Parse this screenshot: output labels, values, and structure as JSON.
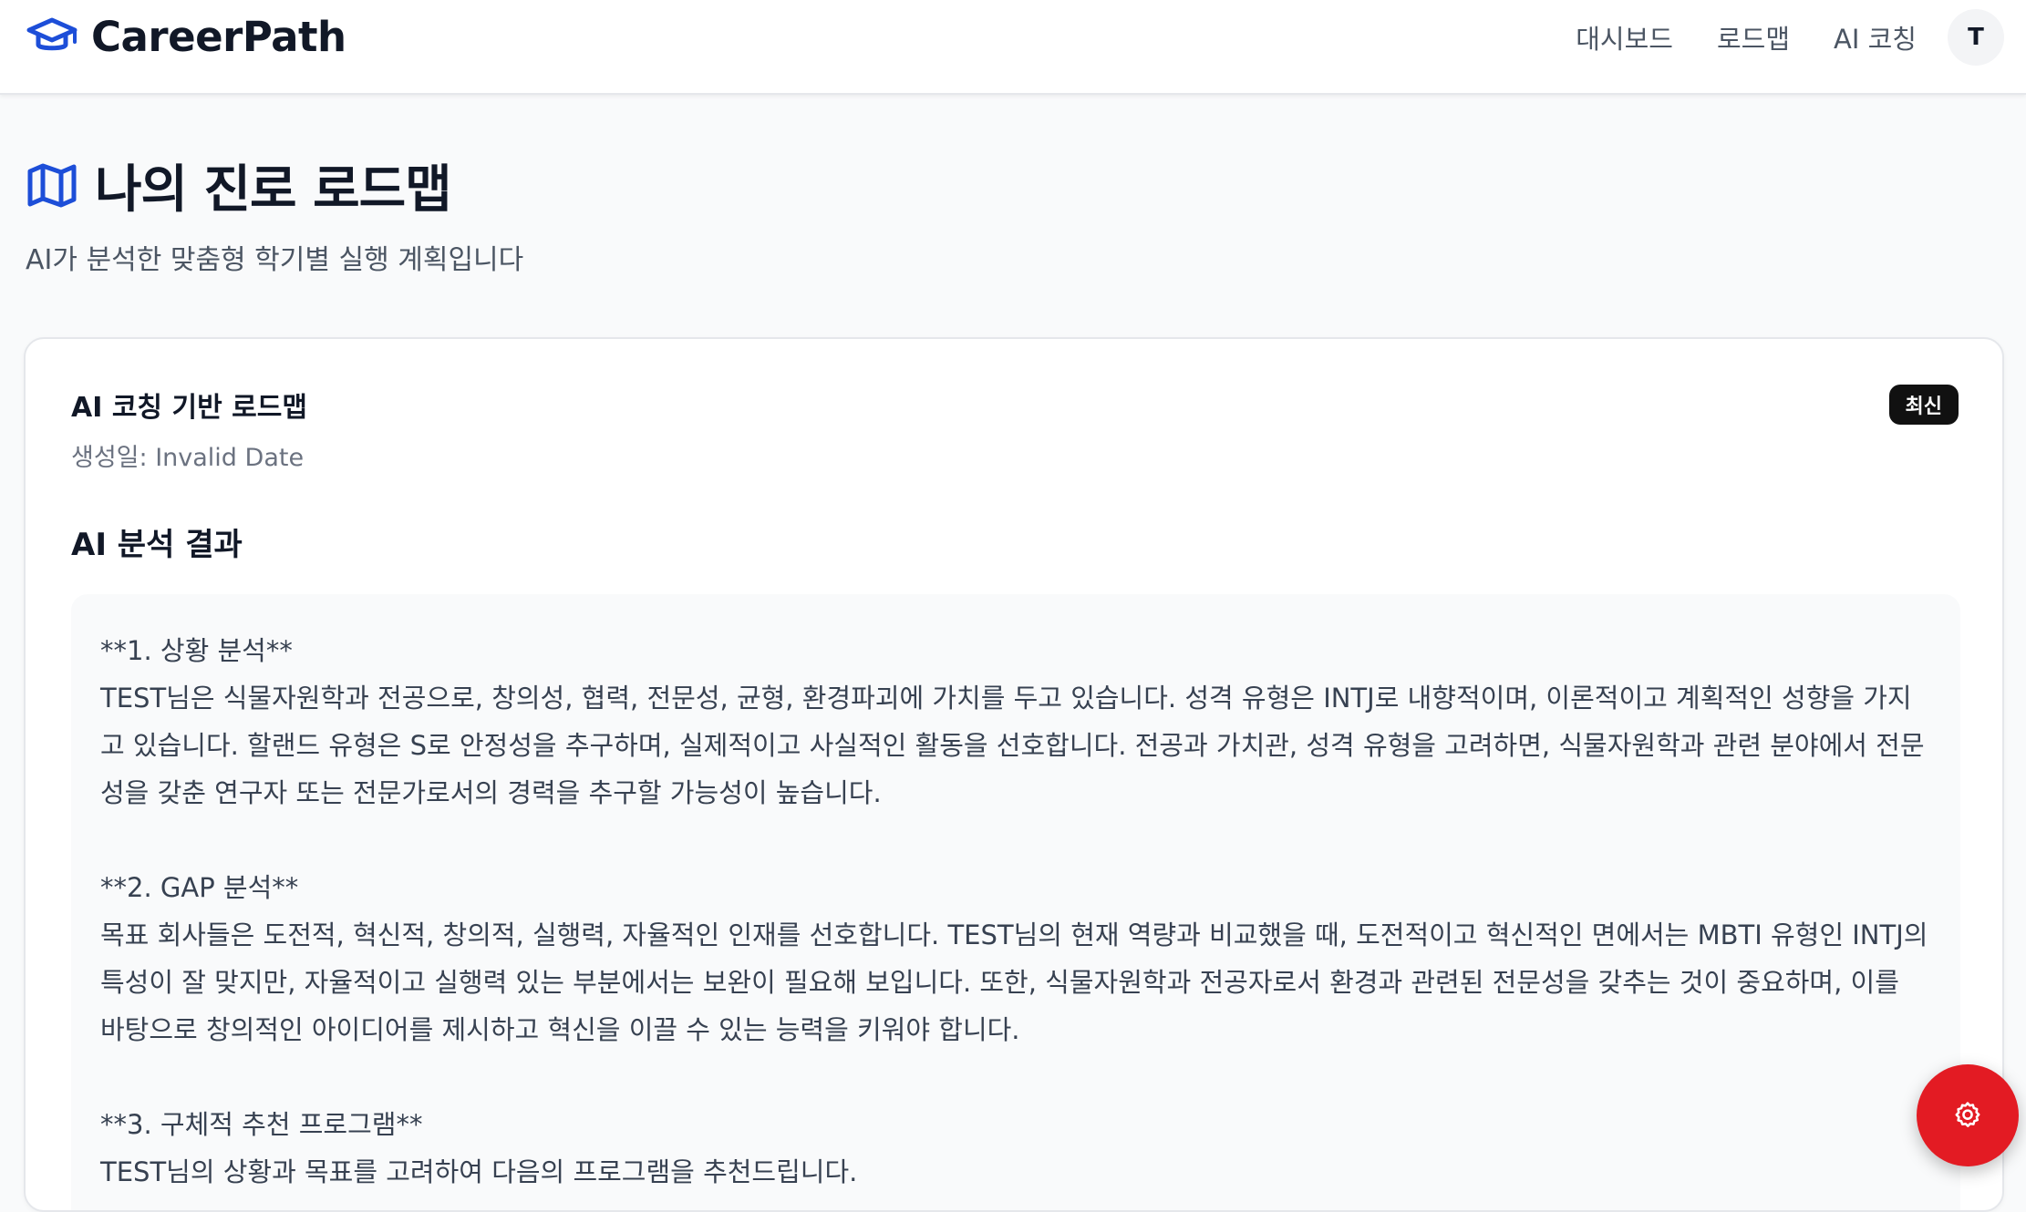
{
  "header": {
    "brand": "CareerPath",
    "nav": [
      "대시보드",
      "로드맵",
      "AI 코칭"
    ],
    "avatar_initial": "T"
  },
  "page": {
    "title": "나의 진로 로드맵",
    "subtitle": "AI가 분석한 맞춤형 학기별 실행 계획입니다"
  },
  "card": {
    "title": "AI 코칭 기반 로드맵",
    "date_label": "생성일: Invalid Date",
    "badge": "최신",
    "section_heading": "AI 분석 결과",
    "analysis_text": "**1. 상황 분석**\nTEST님은 식물자원학과 전공으로, 창의성, 협력, 전문성, 균형, 환경파괴에 가치를 두고 있습니다. 성격 유형은 INTJ로 내향적이며, 이론적이고 계획적인 성향을 가지고 있습니다. 할랜드 유형은 S로 안정성을 추구하며, 실제적이고 사실적인 활동을 선호합니다. 전공과 가치관, 성격 유형을 고려하면, 식물자원학과 관련 분야에서 전문성을 갖춘 연구자 또는 전문가로서의 경력을 추구할 가능성이 높습니다.\n\n**2. GAP 분석**\n목표 회사들은 도전적, 혁신적, 창의적, 실행력, 자율적인 인재를 선호합니다. TEST님의 현재 역량과 비교했을 때, 도전적이고 혁신적인 면에서는 MBTI 유형인 INTJ의 특성이 잘 맞지만, 자율적이고 실행력 있는 부분에서는 보완이 필요해 보입니다. 또한, 식물자원학과 전공자로서 환경과 관련된 전문성을 갖추는 것이 중요하며, 이를 바탕으로 창의적인 아이디어를 제시하고 혁신을 이끌 수 있는 능력을 키워야 합니다.\n\n**3. 구체적 추천 프로그램**\nTEST님의 상황과 목표를 고려하여 다음의 프로그램을 추천드립니다."
  },
  "colors": {
    "brand_blue": "#1d4ed8",
    "fab_red": "#e31b23",
    "badge_bg": "#111111"
  },
  "icons": {
    "brand": "graduation-cap-icon",
    "title": "map-icon",
    "fab": "gear-icon"
  }
}
